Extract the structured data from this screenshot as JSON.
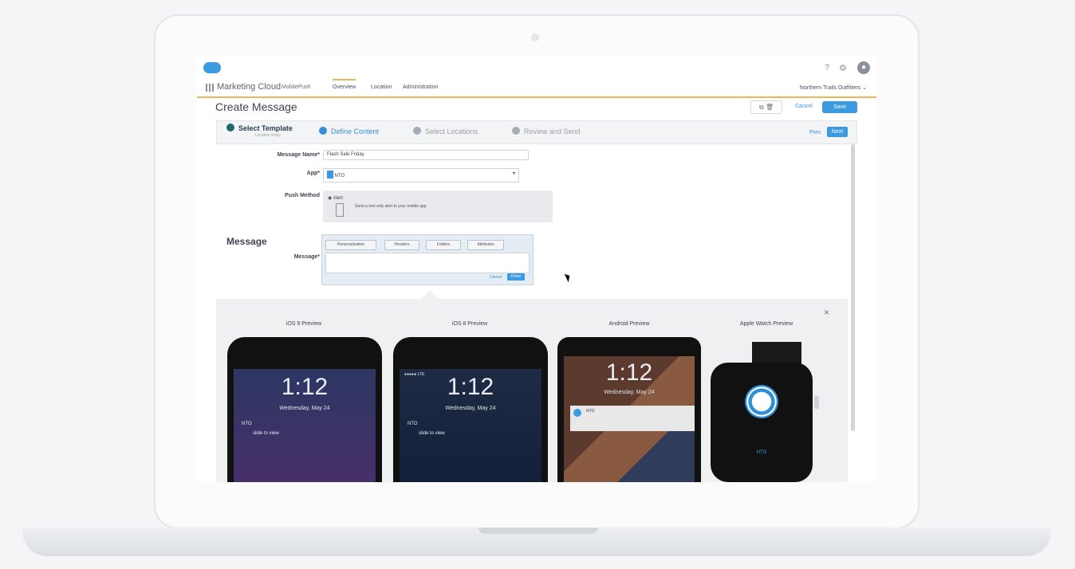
{
  "header": {
    "app_name": "Marketing Cloud",
    "app_sub": "MobilePush",
    "help_icon": "?",
    "tabs": [
      "Overview",
      "Location",
      "Administration"
    ],
    "org": "Northern Trails Outfitters"
  },
  "page": {
    "title": "Create Message",
    "cancel": "Cancel",
    "save": "Save"
  },
  "steps": {
    "items": [
      {
        "label": "Select Template",
        "sub": "Location Entry",
        "state": "done"
      },
      {
        "label": "Define Content",
        "state": "current"
      },
      {
        "label": "Select Locations",
        "state": "todo"
      },
      {
        "label": "Review and Send",
        "state": "todo"
      }
    ],
    "prev": "Prev",
    "next": "Next"
  },
  "form": {
    "name_label": "Message Name*",
    "name_value": "Flash Sale Friday",
    "app_label": "App*",
    "app_value": "NTO",
    "push_label": "Push Method",
    "alert_label": "Alert",
    "alert_desc": "Send a text-only alert to your mobile app",
    "message_heading": "Message",
    "message_label": "Message*",
    "editor_buttons": [
      "Personalization",
      "Headers",
      "Folders",
      "Attributes"
    ],
    "editor_cancel": "Cancel",
    "editor_done": "Done"
  },
  "previews": {
    "labels": [
      "iOS 9 Preview",
      "iOS 8 Preview",
      "Android Preview",
      "Apple Watch Preview"
    ],
    "time": "1:12",
    "date": "Wednesday, May 24",
    "app": "NTO",
    "body": "slide to view",
    "close": "×"
  },
  "colors": {
    "accent": "#3b9ae0",
    "nav_underline": "#e9b65a"
  }
}
